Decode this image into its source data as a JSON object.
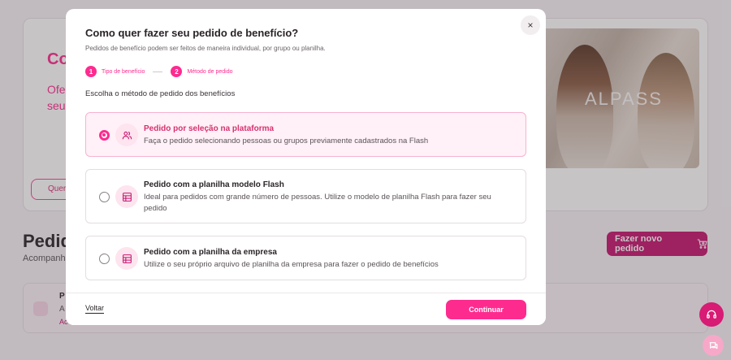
{
  "background": {
    "hero": {
      "title": "Co",
      "text_line1": "Ofe",
      "text_line2": "seu",
      "button_label": "Quer",
      "image_brand": "ALPASS"
    },
    "orders": {
      "title": "Pedido",
      "subtitle": "Acompanhe",
      "new_order_label": "Fazer novo pedido",
      "row": {
        "t1": "P",
        "t2": "A",
        "t3": "Ac"
      }
    }
  },
  "modal": {
    "title": "Como quer fazer seu pedido de benefício?",
    "subtitle": "Pedidos de benefício podem ser feitos de maneira individual, por grupo ou planilha.",
    "close_symbol": "×",
    "steps": [
      {
        "number": "1",
        "label": "Tipo de benefício"
      },
      {
        "number": "2",
        "label": "Método de pedido"
      }
    ],
    "section_title": "Escolha o método de pedido dos benefícios",
    "options": [
      {
        "title": "Pedido por seleção na plataforma",
        "description": "Faça o pedido selecionando pessoas ou grupos previamente cadastrados na Flash",
        "icon": "users-icon",
        "selected": true
      },
      {
        "title": "Pedido com a planilha modelo Flash",
        "description": "Ideal para pedidos com grande número de pessoas. Utilize o modelo de planilha Flash para fazer seu pedido",
        "icon": "table-icon",
        "selected": false
      },
      {
        "title": "Pedido com a planilha da empresa",
        "description": "Utilize o seu próprio arquivo de planilha da empresa para fazer o pedido de benefícios",
        "icon": "table-icon",
        "selected": false
      }
    ],
    "footer": {
      "back_label": "Voltar",
      "continue_label": "Continuar"
    }
  },
  "colors": {
    "accent": "#fe2b8f",
    "accent_dark": "#c4166f",
    "selected_bg": "#fff1f7"
  }
}
